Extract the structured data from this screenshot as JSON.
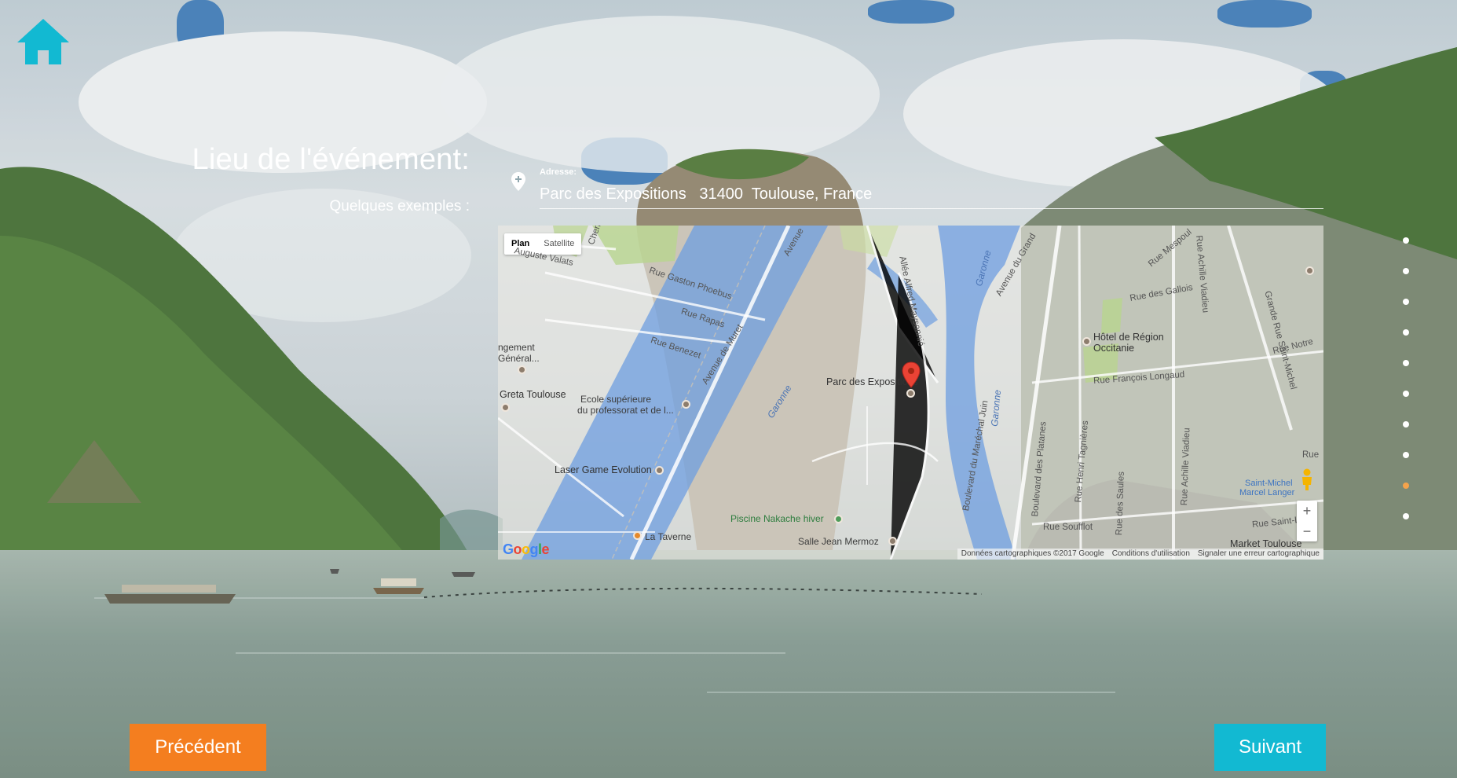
{
  "page": {
    "title": "Lieu de l'événement:",
    "examples_label": "Quelques exemples :"
  },
  "address": {
    "label": "Adresse:",
    "value": "Parc des Expositions   31400  Toulouse, France"
  },
  "map": {
    "type_buttons": [
      "Plan",
      "Satellite"
    ],
    "active_type": "Plan",
    "marker_label": "Parc des Expositions",
    "labels": {
      "chemin": "Chemin de",
      "auguste": "Auguste Valats",
      "avenue_top": "Avenue",
      "gaston": "Rue Gaston Phoebus",
      "rapas": "Rue Rapas",
      "benezet": "Rue Benezet",
      "muret": "Avenue de Muret",
      "ngement": "ngement",
      "general": "Général...",
      "greta": "Greta Toulouse",
      "ecole1": "Ecole supérieure",
      "ecole2": "du professorat et de l...",
      "laser": "Laser Game Evolution",
      "piscine": "Piscine Nakache hiver",
      "taverne": "La Taverne",
      "salle": "Salle Jean Mermoz",
      "garonne1": "Garonne",
      "garonne2": "Garonne",
      "garonne3": "Garonne",
      "maysonnie": "Allée Alfred Maysonnié",
      "avenue_du_grand": "Avenue du Grand",
      "mespoul": "Rue Mespoul",
      "viadieu_top": "Rue Achille Viadieu",
      "grande_rue": "Grande Rue Saint-Michel",
      "gallois": "Rue des Gallois",
      "hotel1": "Hôtel de Région",
      "hotel2": "Occitanie",
      "notre": "Rue Notre",
      "longaud": "Rue François Longaud",
      "juin": "Boulevard du Maréchal Juin",
      "platanes": "Boulevard des Platanes",
      "tagnieres": "Rue Henri Tagnières",
      "saules": "Rue des Saules",
      "viadieu_bottom": "Rue Achille Viadieu",
      "rue_right": "Rue",
      "saint_michel": "Saint-Michel",
      "marcel": "Marcel Langer",
      "soufflot": "Rue Soufflot",
      "saint_l": "Rue Saint-L",
      "market": "Market Toulouse"
    },
    "google": [
      "G",
      "o",
      "o",
      "g",
      "l",
      "e"
    ],
    "google_colors": [
      "#4285f4",
      "#ea4335",
      "#fbbc05",
      "#4285f4",
      "#34a853",
      "#ea4335"
    ],
    "footer": {
      "data": "Données cartographiques ©2017 Google",
      "terms": "Conditions d'utilisation",
      "report": "Signaler une erreur cartographique"
    },
    "zoom_in": "+",
    "zoom_out": "−"
  },
  "nav_dots": {
    "count": 10,
    "active_index": 8
  },
  "buttons": {
    "previous": "Précédent",
    "next": "Suivant"
  },
  "colors": {
    "home": "#12b9d2",
    "previous": "#f47e1f",
    "next": "#12b9d2",
    "active_dot": "#f4a34c"
  }
}
